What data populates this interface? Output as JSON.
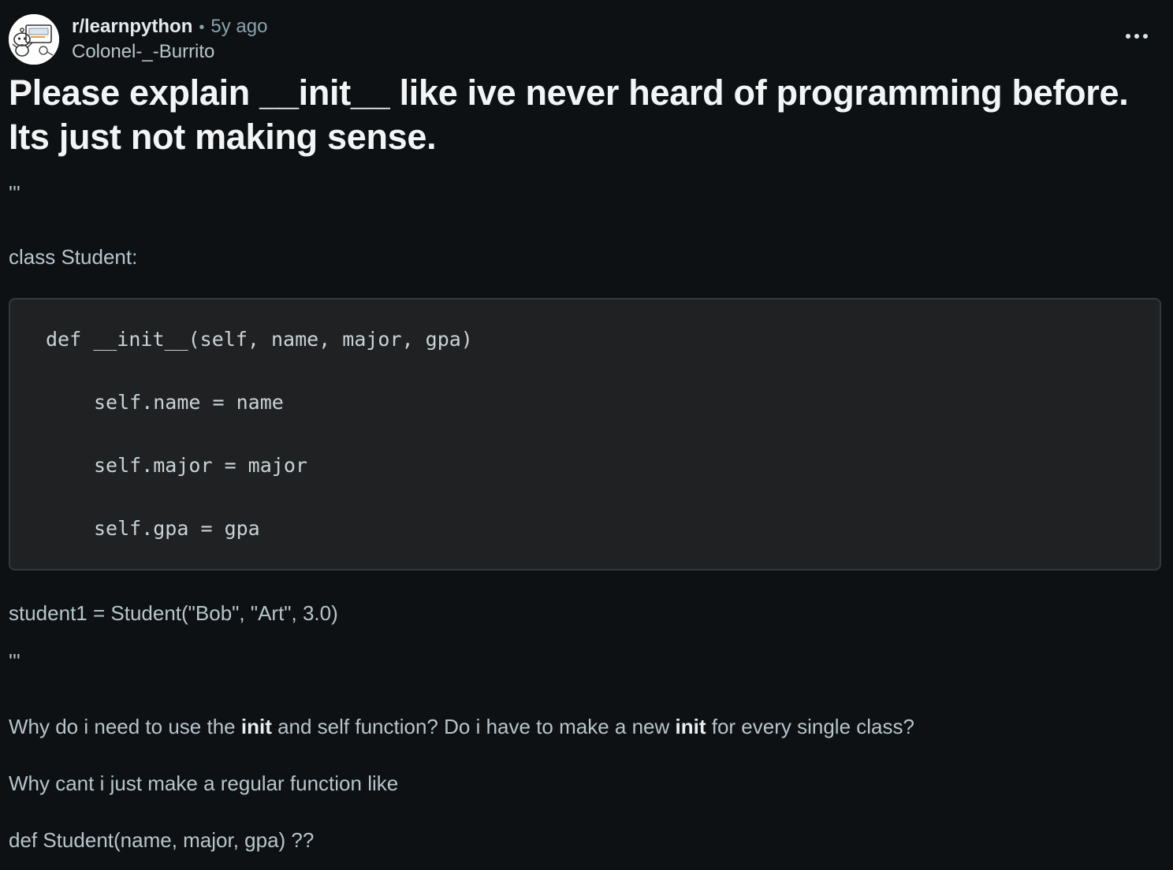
{
  "post": {
    "subreddit": "r/learnpython",
    "separator": "•",
    "age": "5y ago",
    "author": "Colonel-_-Burrito",
    "title": "Please explain __init__ like ive never heard of programming before. Its just not making sense.",
    "more_icon": "ellipsis-icon"
  },
  "body": {
    "quote_open": "'''",
    "class_line": "class Student:",
    "code_lines": [
      "def __init__(self, name, major, gpa)",
      "self.name = name",
      "self.major = major",
      "self.gpa = gpa"
    ],
    "student_line": "student1 = Student(\"Bob\", \"Art\", 3.0)",
    "quote_close": "'''",
    "question1": {
      "part1": "Why do i need to use the ",
      "bold1": "init",
      "part2": " and self function? Do i have to make a new ",
      "bold2": "init",
      "part3": " for every single class?"
    },
    "question2": "Why cant i just make a regular function like",
    "question3": "def Student(name, major, gpa) ??"
  },
  "colors": {
    "background": "#0e1113",
    "code_background": "#202122",
    "text": "#b7c5cc",
    "title": "#f2f4f5"
  }
}
